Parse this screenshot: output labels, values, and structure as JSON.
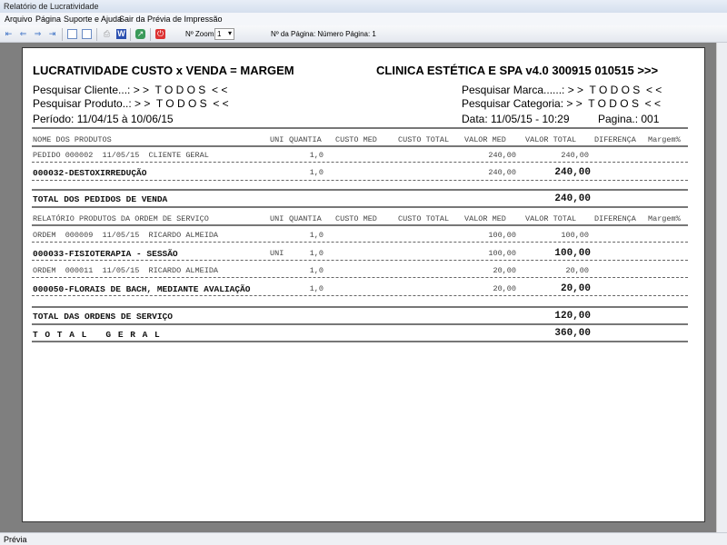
{
  "window": {
    "title": "Relatório de Lucratividade"
  },
  "menu": [
    "Arquivo",
    "Página",
    "Suporte e Ajuda",
    "Sair da Prévia de Impressão"
  ],
  "toolbar": {
    "zoom_label": "Nº Zoom",
    "zoom_value": "1",
    "page_label": "Nº da Página: Número Página: 1"
  },
  "status": "Prévia",
  "report": {
    "title": "LUCRATIVIDADE CUSTO x VENDA = MARGEM",
    "company": "CLINICA ESTÉTICA E SPA v4.0 300915 010515 >>>",
    "cliente": "Pesquisar Cliente...: > >  T O D O S  < <",
    "produto": "Pesquisar Produto..: > >  T O D O S  < <",
    "marca": "Pesquisar Marca......: > >  T O D O S  < <",
    "categoria": "Pesquisar Categoria: > >  T O D O S  < <",
    "periodo": "Período: 11/04/15 à 10/06/15",
    "data": "Data: 11/05/15 - 10:29",
    "pagina": "Pagina.: 001",
    "columns": [
      "NOME DOS PRODUTOS",
      "UNI",
      "QUANTIA",
      "CUSTO MED",
      "CUSTO TOTAL",
      "VALOR MED",
      "VALOR TOTAL",
      "DIFERENÇA",
      "Margem%"
    ],
    "section2_title": "RELATÓRIO PRODUTOS DA ORDEM DE SERVIÇO",
    "rows1": [
      {
        "name": "PEDIDO 000002  11/05/15  CLIENTE GERAL",
        "uni": "",
        "qty": "1,0",
        "vmed": "240,00",
        "vtot": "240,00",
        "kind": "head"
      },
      {
        "name": "000032-DESTOXIRREDUÇÃO",
        "uni": "",
        "qty": "1,0",
        "vmed": "240,00",
        "vtot": "240,00",
        "kind": "item"
      }
    ],
    "total_vendas_label": "TOTAL DOS PEDIDOS DE VENDA",
    "total_vendas": "240,00",
    "rows2": [
      {
        "name": "ORDEM  000009  11/05/15  RICARDO ALMEIDA",
        "uni": "",
        "qty": "1,0",
        "vmed": "100,00",
        "vtot": "100,00",
        "kind": "head"
      },
      {
        "name": "000033-FISIOTERAPIA - SESSÃO",
        "uni": "UNI",
        "qty": "1,0",
        "vmed": "100,00",
        "vtot": "100,00",
        "kind": "item"
      },
      {
        "name": "ORDEM  000011  11/05/15  RICARDO ALMEIDA",
        "uni": "",
        "qty": "1,0",
        "vmed": "20,00",
        "vtot": "20,00",
        "kind": "head"
      },
      {
        "name": "000050-FLORAIS DE BACH, MEDIANTE AVALIAÇÃO",
        "uni": "",
        "qty": "1,0",
        "vmed": "20,00",
        "vtot": "20,00",
        "kind": "item"
      }
    ],
    "total_os_label": "TOTAL DAS ORDENS DE SERVIÇO",
    "total_os": "120,00",
    "total_geral_label": "T O T A L   G E R A L",
    "total_geral": "360,00"
  }
}
